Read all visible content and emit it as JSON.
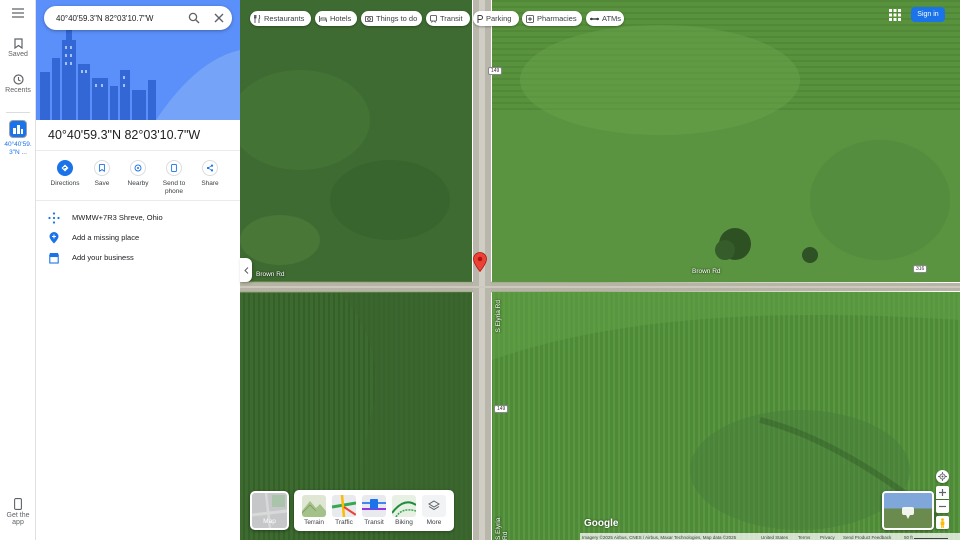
{
  "search": {
    "value": "40°40'59.3\"N 82°03'10.7\"W"
  },
  "rail": {
    "saved_label": "Saved",
    "recents_label": "Recents",
    "recent_place_label": "40°40'59.3\"N ...",
    "get_app_label": "Get the app"
  },
  "place": {
    "title": "40°40'59.3\"N 82°03'10.7\"W",
    "actions": [
      {
        "label": "Directions",
        "icon": "directions-icon"
      },
      {
        "label": "Save",
        "icon": "bookmark-icon"
      },
      {
        "label": "Nearby",
        "icon": "nearby-icon"
      },
      {
        "label": "Send to phone",
        "icon": "phone-icon"
      },
      {
        "label": "Share",
        "icon": "share-icon"
      }
    ],
    "plus_code": "MWMW+7R3 Shreve, Ohio",
    "add_missing": "Add a missing place",
    "add_business": "Add your business"
  },
  "chips": [
    {
      "label": "Restaurants",
      "icon": "fork-knife-icon"
    },
    {
      "label": "Hotels",
      "icon": "bed-icon"
    },
    {
      "label": "Things to do",
      "icon": "camera-icon"
    },
    {
      "label": "Transit",
      "icon": "train-icon"
    },
    {
      "label": "Parking",
      "icon": "parking-icon"
    },
    {
      "label": "Pharmacies",
      "icon": "pharmacy-icon"
    },
    {
      "label": "ATMs",
      "icon": "atm-icon"
    }
  ],
  "header": {
    "sign_in_label": "Sign in"
  },
  "layers": {
    "map_toggle_label": "Map",
    "items": [
      {
        "label": "Terrain"
      },
      {
        "label": "Traffic"
      },
      {
        "label": "Transit"
      },
      {
        "label": "Biking"
      },
      {
        "label": "More"
      }
    ]
  },
  "map": {
    "road_labels": [
      "Brown Rd",
      "Brown Rd",
      "S Elyria Rd",
      "S Elyria Rd"
    ],
    "shields": [
      "149",
      "149",
      "316"
    ],
    "google_logo": "Google"
  },
  "footer": {
    "imagery": "Imagery ©2025 Airbus, CNES / Airbus, Maxar Technologies, Map data ©2025",
    "country": "United States",
    "terms": "Terms",
    "privacy": "Privacy",
    "feedback": "Send Product Feedback",
    "scale": "50 ft"
  },
  "colors": {
    "accent": "#1a73e8",
    "pin": "#ea4335",
    "field_light": "#5e9a3f",
    "field_dark": "#3f6a32"
  }
}
